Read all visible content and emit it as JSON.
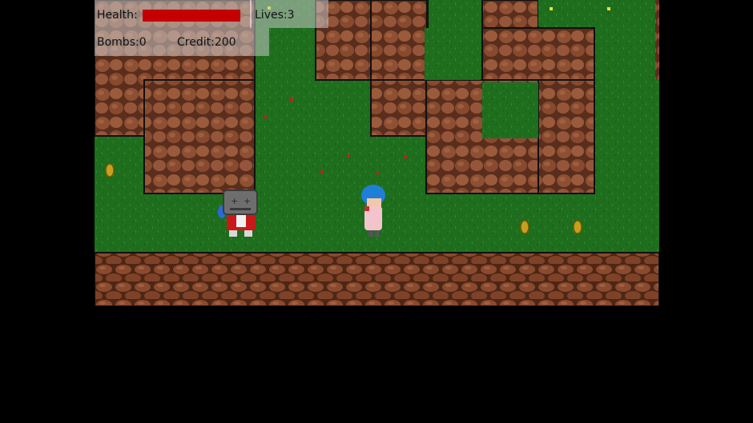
{
  "hud": {
    "health_label": "Health:",
    "health_fraction": 1.0,
    "lives_label": "Lives:",
    "lives_value": "3",
    "bombs_label": "Bombs:",
    "bombs_value": "0",
    "credit_label": "Credit:",
    "credit_value": "200"
  },
  "colors": {
    "grass": "#1e6e1e",
    "rock": "#8a4a2e",
    "health": "#c40000",
    "hud_panel": "#c8c8c8"
  },
  "entities": {
    "player": "blue-haired-hero",
    "enemy": "helmet-knight",
    "pickups": [
      "gold-coin",
      "gold-coin",
      "gold-coin"
    ]
  }
}
